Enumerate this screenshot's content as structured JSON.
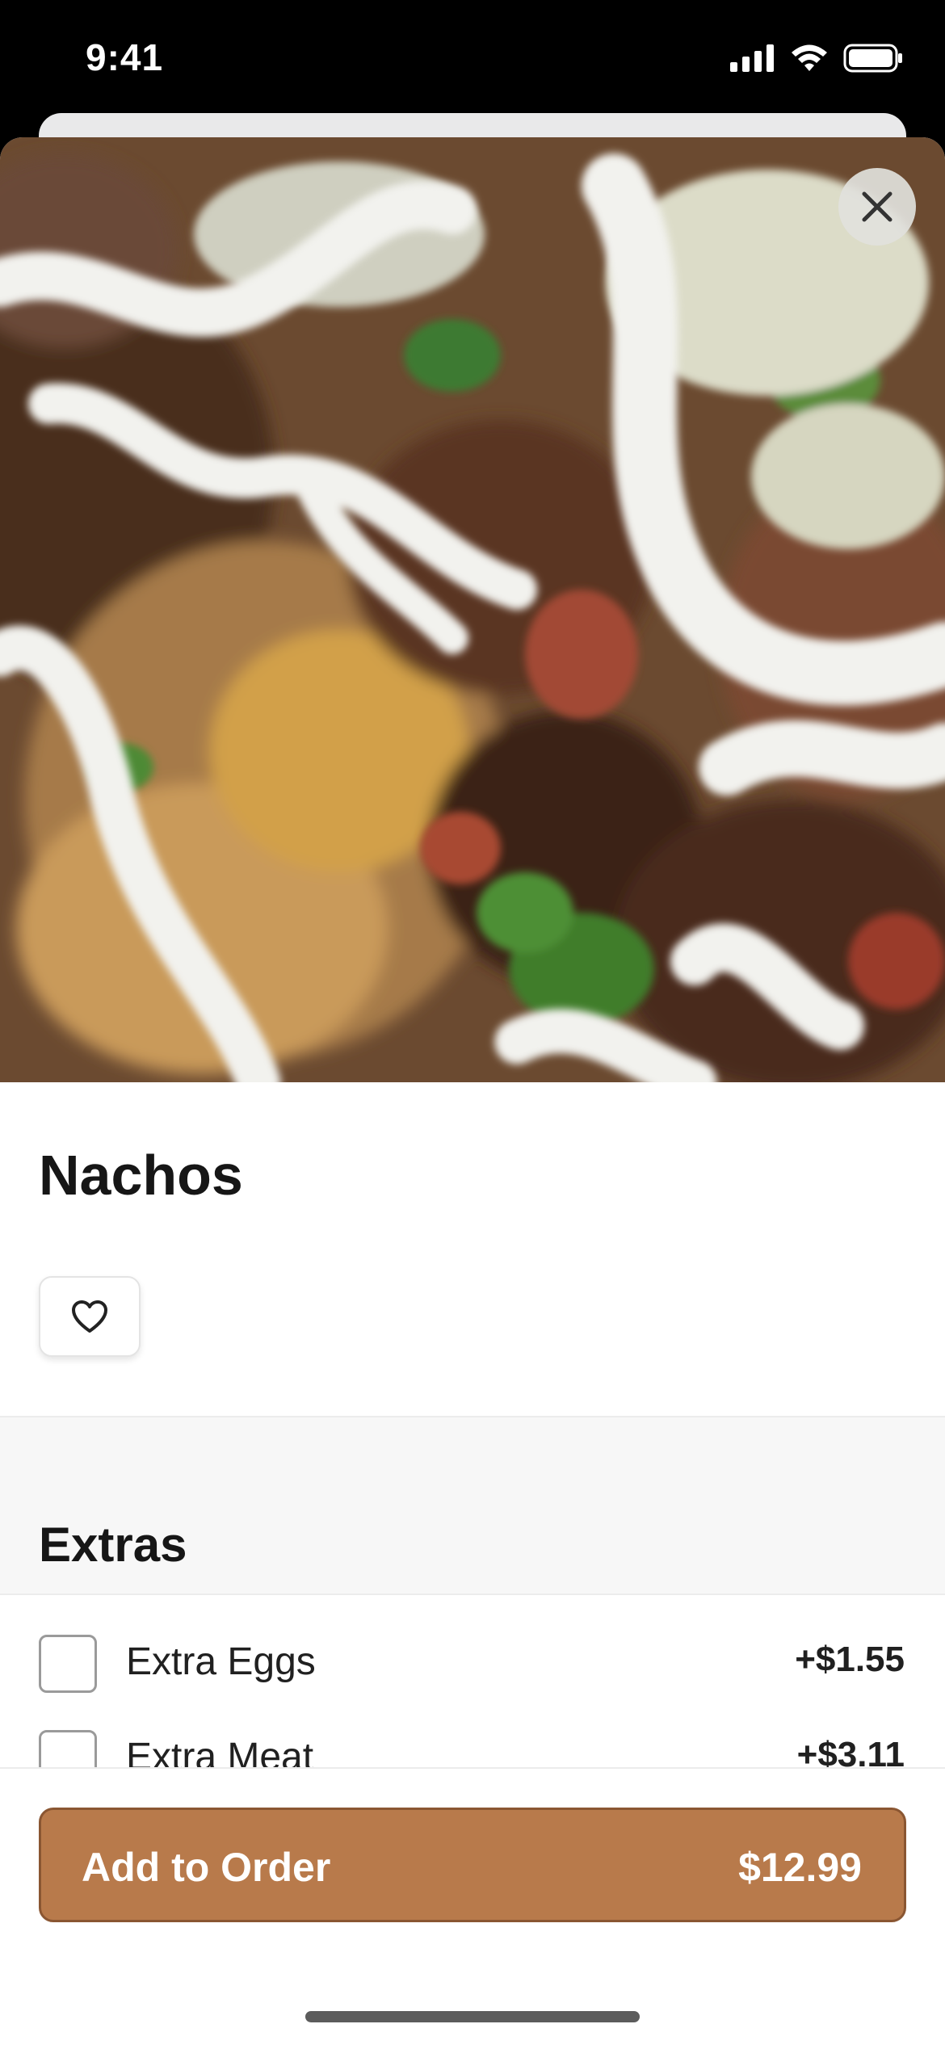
{
  "status_bar": {
    "time": "9:41",
    "icons": [
      "signal-icon",
      "wifi-icon",
      "battery-icon"
    ]
  },
  "item": {
    "name": "Nachos",
    "image_alt": "Nachos photo",
    "close_icon": "close-icon",
    "favorite_icon": "heart-icon"
  },
  "extras": {
    "title": "Extras",
    "options": [
      {
        "label": "Extra Eggs",
        "price": "+$1.55",
        "checked": false
      },
      {
        "label": "Extra Meat",
        "price": "+$3.11",
        "checked": false
      }
    ]
  },
  "footer": {
    "button_label": "Add to Order",
    "button_price": "$12.99",
    "accent_color": "#b87a4b"
  }
}
